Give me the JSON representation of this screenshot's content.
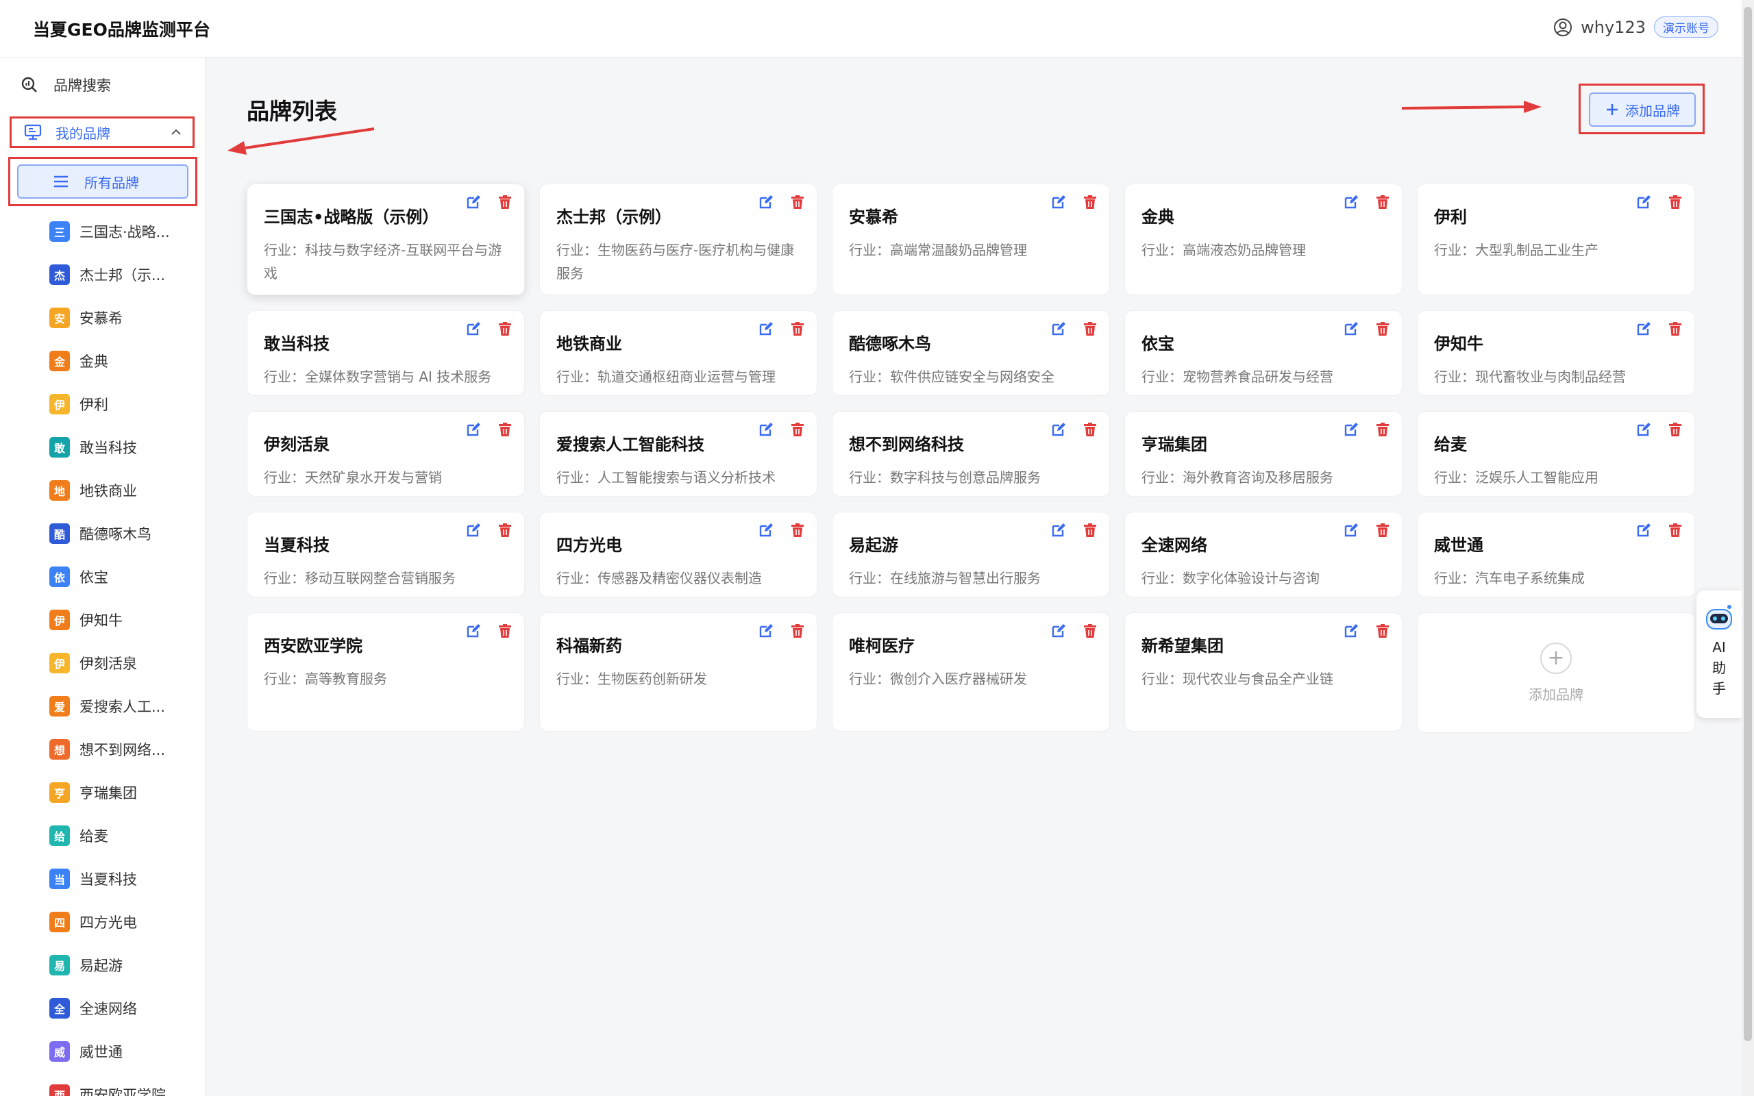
{
  "app": {
    "title": "当夏GEO品牌监测平台"
  },
  "user": {
    "name": "why123",
    "badge": "演示账号"
  },
  "sidebar": {
    "search_label": "品牌搜索",
    "my_brands_label": "我的品牌",
    "all_brands_label": "所有品牌",
    "brands": [
      {
        "char": "三",
        "label": "三国志·战略...",
        "color": "#3b82f6"
      },
      {
        "char": "杰",
        "label": "杰士邦（示...",
        "color": "#2f5bd9"
      },
      {
        "char": "安",
        "label": "安慕希",
        "color": "#f5a524"
      },
      {
        "char": "金",
        "label": "金典",
        "color": "#f07d1a"
      },
      {
        "char": "伊",
        "label": "伊利",
        "color": "#f7b52c"
      },
      {
        "char": "敢",
        "label": "敢当科技",
        "color": "#14a3a8"
      },
      {
        "char": "地",
        "label": "地铁商业",
        "color": "#f07d1a"
      },
      {
        "char": "酷",
        "label": "酷德啄木鸟",
        "color": "#2f5bd9"
      },
      {
        "char": "依",
        "label": "依宝",
        "color": "#3b82f6"
      },
      {
        "char": "伊",
        "label": "伊知牛",
        "color": "#f07d1a"
      },
      {
        "char": "伊",
        "label": "伊刻活泉",
        "color": "#f7b52c"
      },
      {
        "char": "爱",
        "label": "爱搜索人工...",
        "color": "#f07d1a"
      },
      {
        "char": "想",
        "label": "想不到网络...",
        "color": "#ef6a2b"
      },
      {
        "char": "亨",
        "label": "亨瑞集团",
        "color": "#f5a524"
      },
      {
        "char": "给",
        "label": "给麦",
        "color": "#1fb6b0"
      },
      {
        "char": "当",
        "label": "当夏科技",
        "color": "#3b82f6"
      },
      {
        "char": "四",
        "label": "四方光电",
        "color": "#f07d1a"
      },
      {
        "char": "易",
        "label": "易起游",
        "color": "#1fb6b0"
      },
      {
        "char": "全",
        "label": "全速网络",
        "color": "#2f5bd9"
      },
      {
        "char": "威",
        "label": "威世通",
        "color": "#7b6cf0"
      },
      {
        "char": "西",
        "label": "西安欧亚学院",
        "color": "#e23b3b"
      }
    ]
  },
  "main": {
    "title": "品牌列表",
    "add_button_label": "添加品牌",
    "add_card_label": "添加品牌",
    "cards": [
      {
        "name": "三国志•战略版（示例）",
        "industry": "行业：科技与数字经济-互联网平台与游戏"
      },
      {
        "name": "杰士邦（示例）",
        "industry": "行业：生物医药与医疗-医疗机构与健康服务"
      },
      {
        "name": "安慕希",
        "industry": "行业：高端常温酸奶品牌管理"
      },
      {
        "name": "金典",
        "industry": "行业：高端液态奶品牌管理"
      },
      {
        "name": "伊利",
        "industry": "行业：大型乳制品工业生产"
      },
      {
        "name": "敢当科技",
        "industry": "行业：全媒体数字营销与 AI 技术服务"
      },
      {
        "name": "地铁商业",
        "industry": "行业：轨道交通枢纽商业运营与管理"
      },
      {
        "name": "酷德啄木鸟",
        "industry": "行业：软件供应链安全与网络安全"
      },
      {
        "name": "依宝",
        "industry": "行业：宠物营养食品研发与经营"
      },
      {
        "name": "伊知牛",
        "industry": "行业：现代畜牧业与肉制品经营"
      },
      {
        "name": "伊刻活泉",
        "industry": "行业：天然矿泉水开发与营销"
      },
      {
        "name": "爱搜索人工智能科技",
        "industry": "行业：人工智能搜索与语义分析技术"
      },
      {
        "name": "想不到网络科技",
        "industry": "行业：数字科技与创意品牌服务"
      },
      {
        "name": "亨瑞集团",
        "industry": "行业：海外教育咨询及移居服务"
      },
      {
        "name": "给麦",
        "industry": "行业：泛娱乐人工智能应用"
      },
      {
        "name": "当夏科技",
        "industry": "行业：移动互联网整合营销服务"
      },
      {
        "name": "四方光电",
        "industry": "行业：传感器及精密仪器仪表制造"
      },
      {
        "name": "易起游",
        "industry": "行业：在线旅游与智慧出行服务"
      },
      {
        "name": "全速网络",
        "industry": "行业：数字化体验设计与咨询"
      },
      {
        "name": "威世通",
        "industry": "行业：汽车电子系统集成"
      },
      {
        "name": "西安欧亚学院",
        "industry": "行业：高等教育服务"
      },
      {
        "name": "科福新药",
        "industry": "行业：生物医药创新研发"
      },
      {
        "name": "唯柯医疗",
        "industry": "行业：微创介入医疗器械研发"
      },
      {
        "name": "新希望集团",
        "industry": "行业：现代农业与食品全产业链"
      }
    ]
  },
  "ai_helper": {
    "label": "AI助手"
  },
  "colors": {
    "accent": "#3a6bf0",
    "annotation": "#e23b3b",
    "delete": "#e23b3b"
  }
}
